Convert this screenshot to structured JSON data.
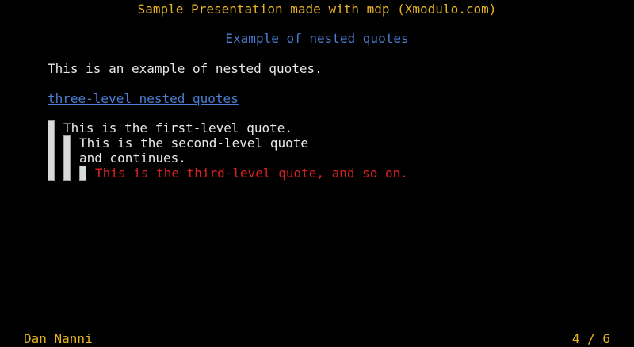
{
  "header": {
    "title": "Sample Presentation made with mdp (Xmodulo.com)"
  },
  "slide": {
    "heading": "Example of nested quotes",
    "intro": "This is an example of nested quotes.",
    "subheading": "three-level nested quotes",
    "quotes": {
      "level1": "This is the first-level quote.",
      "level2_line1": "This is the second-level quote",
      "level2_line2": "and continues.",
      "level3": "This is the third-level quote, and so on."
    }
  },
  "footer": {
    "author": "Dan Nanni",
    "page": "4 / 6"
  },
  "colors": {
    "background": "#000000",
    "title": "#e6b422",
    "heading_link": "#4a7fd4",
    "body_text": "#e8e8e8",
    "third_level_quote": "#e02020",
    "quote_bar": "#d9d9d9"
  }
}
